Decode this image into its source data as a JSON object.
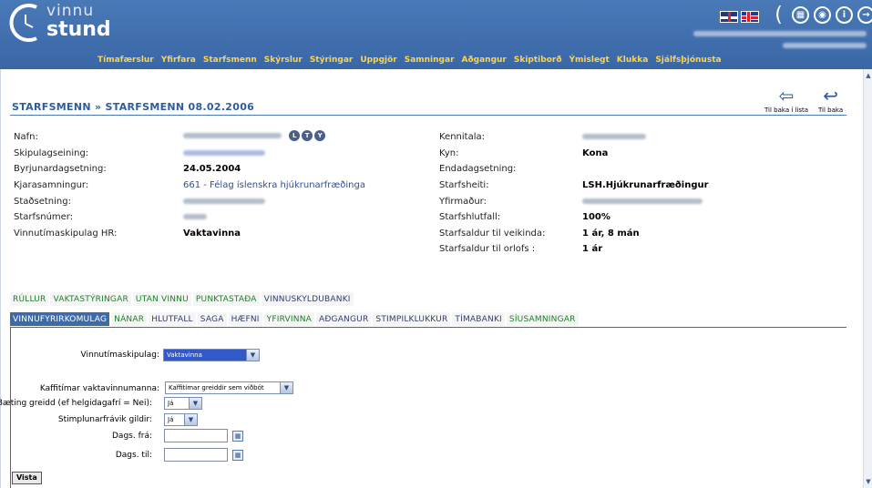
{
  "logo": {
    "line1": "vinnu",
    "line2": "stund"
  },
  "flags": [
    "flag-uk",
    "flag-is"
  ],
  "header_icons": [
    {
      "name": "moon-icon",
      "glyph": "("
    },
    {
      "name": "calendar-icon",
      "glyph": "▦"
    },
    {
      "name": "target-icon",
      "glyph": "◉"
    },
    {
      "name": "info-icon",
      "glyph": "i"
    },
    {
      "name": "logout-arrow-icon",
      "glyph": "→"
    }
  ],
  "nav": [
    "Tímafærslur",
    "Yfirfara",
    "Starfsmenn",
    "Skýrslur",
    "Stýringar",
    "Uppgjör",
    "Samningar",
    "Aðgangur",
    "Skiptiborð",
    "Ýmislegt",
    "Klukka",
    "Sjálfsþjónusta"
  ],
  "page_title": "STARFSMENN » STARFSMENN 08.02.2006",
  "toolbar": {
    "back_to_list": "Til baka í lista",
    "back": "Til baka"
  },
  "badges": [
    "L",
    "T",
    "Y"
  ],
  "left_fields": [
    {
      "label": "Nafn:",
      "value": ""
    },
    {
      "label": "Skipulagseining:",
      "value": ""
    },
    {
      "label": "Byrjunardagsetning:",
      "value": "24.05.2004"
    },
    {
      "label": "Kjarasamningur:",
      "value": "661 - Félag íslenskra hjúkrunarfræðinga"
    },
    {
      "label": "Staðsetning:",
      "value": ""
    },
    {
      "label": "Starfsnúmer:",
      "value": ""
    },
    {
      "label": "Vinnutímaskipulag HR:",
      "value": "Vaktavinna"
    }
  ],
  "right_fields": [
    {
      "label": "Kennitala:",
      "value": ""
    },
    {
      "label": "Kyn:",
      "value": "Kona"
    },
    {
      "label": "Endadagsetning:",
      "value": ""
    },
    {
      "label": "Starfsheiti:",
      "value": "LSH.Hjúkrunarfræðingur"
    },
    {
      "label": "Yfirmaður:",
      "value": ""
    },
    {
      "label": "Starfshlutfall:",
      "value": "100%"
    },
    {
      "label": "Starfsaldur til veikinda:",
      "value": "1 ár, 8 mán"
    },
    {
      "label": "Starfsaldur til orlofs :",
      "value": "1 ár"
    }
  ],
  "tabs_row1": [
    "RÚLLUR",
    "VAKTASTÝRINGAR",
    "UTAN VINNU",
    "PUNKTASTAÐA",
    "VINNUSKYLDUBANKI"
  ],
  "tabs_row2": [
    "VINNUFYRIRKOMULAG",
    "NÁNAR",
    "HLUTFALL",
    "SAGA",
    "HÆFNI",
    "YFIRVINNA",
    "AÐGANGUR",
    "STIMPILKLUKKUR",
    "TÍMABANKI",
    "SÍUSAMNINGAR"
  ],
  "form": {
    "vinnutimaskipulag_label": "Vinnutímaskipulag:",
    "vinnutimaskipulag_value": "Vaktavinna",
    "kaffitimar_label": "Kaffitímar vaktavinnumanna:",
    "kaffitimar_value": "Kaffitímar greiddir sem viðbót",
    "baeting_label": "Bæting greidd (ef helgidagafrí = Nei):",
    "baeting_value": "Já",
    "stimplun_label": "Stimplunarfrávik gildir:",
    "stimplun_value": "Já",
    "dags_fra_label": "Dags. frá:",
    "dags_fra_value": "",
    "dags_til_label": "Dags. til:",
    "dags_til_value": ""
  },
  "vista_button": "Vista",
  "colors": {
    "header": "#4a79b8",
    "nav_text": "#ffd44a",
    "title": "#2b5da0",
    "tab_green": "#1e7d2b",
    "tab_active": "#3d6ba8"
  }
}
